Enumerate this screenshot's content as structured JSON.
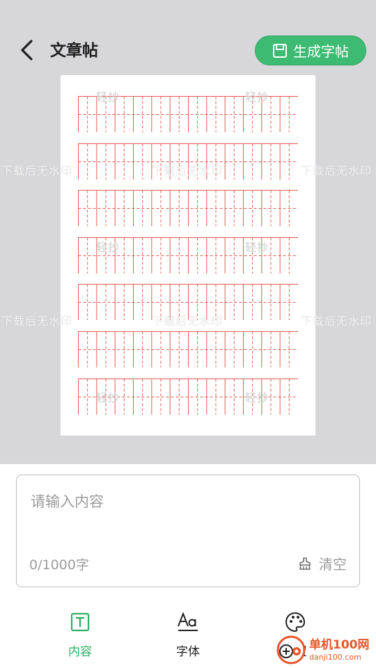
{
  "header": {
    "title": "文章帖",
    "generate_label": "生成字帖"
  },
  "paper": {
    "rows": 7,
    "cells_per_row": 12,
    "grid_color": "#e35b4f",
    "watermarks": {
      "brand": "轻抄",
      "notice": "下载后无水印"
    }
  },
  "input": {
    "placeholder": "请输入内容",
    "value": "",
    "counter": "0/1000字",
    "clear_label": "清空"
  },
  "nav": {
    "items": [
      {
        "label": "内容",
        "icon": "text-box-icon",
        "active": true
      },
      {
        "label": "字体",
        "icon": "font-icon",
        "active": false
      },
      {
        "label": "设置",
        "icon": "palette-icon",
        "active": false
      }
    ]
  },
  "brand": {
    "name": "单机100网",
    "url": "danji100.com"
  },
  "colors": {
    "accent": "#3dbb72",
    "background_top": "#d7d6d9"
  }
}
